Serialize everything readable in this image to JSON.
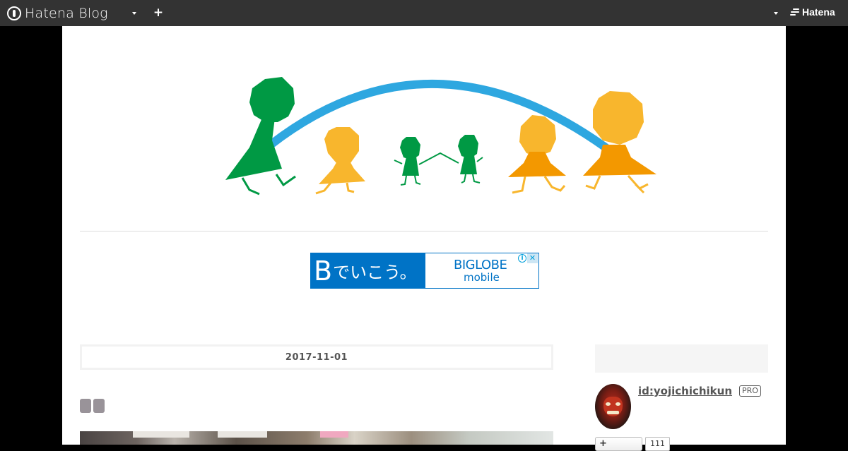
{
  "topbar": {
    "brand_name": "Hatena Blog",
    "plus_label": "+",
    "hatena_label": "Hatena"
  },
  "ad": {
    "headline_b": "B",
    "headline_rest": "でいこう。",
    "brand": "BIGLOBE",
    "sub": "mobile",
    "info_label": "i",
    "close_label": "✕"
  },
  "entry": {
    "date": "2017-11-01"
  },
  "sidebar": {
    "user_id": "id:yojichichikun",
    "pro_label": "PRO",
    "subscribe_label": "+",
    "subscribe_count": "111"
  },
  "colors": {
    "topbar": "#333333",
    "arc_blue": "#2ea7e0",
    "green": "#009944",
    "yellow": "#f8b62d",
    "orange": "#f39800",
    "ad_blue": "#0073c6"
  }
}
